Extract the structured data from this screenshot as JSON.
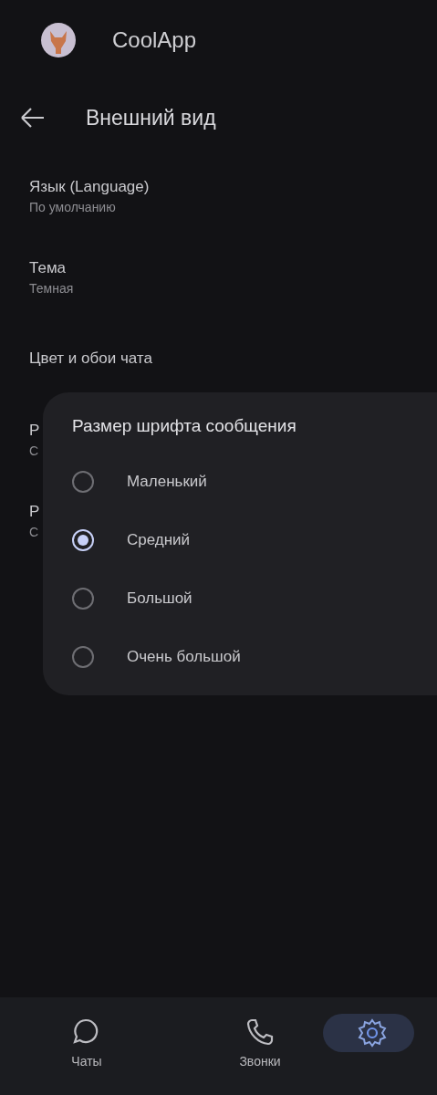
{
  "app_bar": {
    "title": "CoolApp"
  },
  "page": {
    "title": "Внешний вид"
  },
  "settings": [
    {
      "title": "Язык (Language)",
      "value": "По умолчанию"
    },
    {
      "title": "Тема",
      "value": "Темная"
    },
    {
      "title": "Цвет и обои чата"
    },
    {
      "title": "Р",
      "value": "С"
    },
    {
      "title": "Р",
      "value": "С"
    }
  ],
  "dialog": {
    "title": "Размер шрифта сообщения",
    "options": [
      {
        "label": "Маленький",
        "selected": false
      },
      {
        "label": "Средний",
        "selected": true
      },
      {
        "label": "Большой",
        "selected": false
      },
      {
        "label": "Очень большой",
        "selected": false
      }
    ]
  },
  "bottom_nav": [
    {
      "kind": "chat",
      "label": "Чаты",
      "selected": false
    },
    {
      "kind": "phone",
      "label": "Звонки",
      "selected": false
    },
    {
      "kind": "settings",
      "selected": true
    }
  ]
}
